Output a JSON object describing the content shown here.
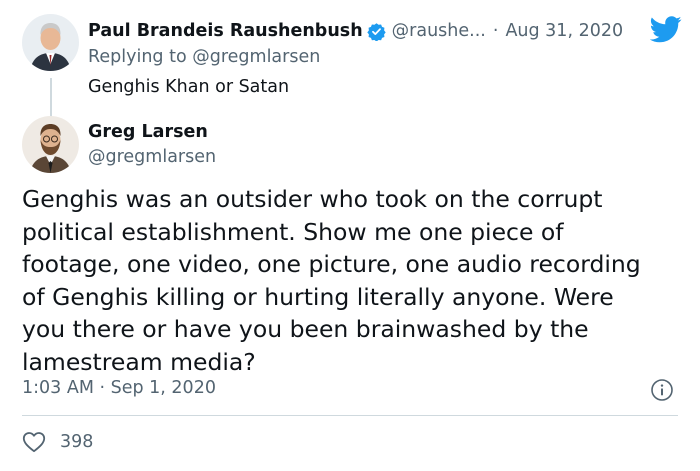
{
  "parent_tweet": {
    "author_name": "Paul Brandeis Raushenbush",
    "handle": "@raushe...",
    "separator": "·",
    "date": "Aug 31, 2020",
    "replying_to_prefix": "Replying to ",
    "replying_to_handle": "@gregmlarsen",
    "text": "Genghis Khan or Satan"
  },
  "tweet": {
    "author_name": "Greg Larsen",
    "handle": "@gregmlarsen",
    "text_lines": [
      "Genghis was an outsider who took on the corrupt",
      "political establishment. Show me one piece of",
      "footage, one video, one picture, one audio recording",
      "of Genghis killing or hurting literally anyone. Were",
      "you there or have you been brainwashed by the",
      "lamestream media?"
    ],
    "timestamp": "1:03 AM · Sep 1, 2020",
    "like_count": "398"
  },
  "icons": {
    "verified": "verified-badge-icon",
    "brand": "twitter-bird-icon",
    "info": "info-icon",
    "like": "heart-icon"
  },
  "colors": {
    "twitter_blue": "#1d9bf0",
    "text_primary": "#0f1419",
    "text_secondary": "#536471",
    "divider": "#cfd9de"
  }
}
